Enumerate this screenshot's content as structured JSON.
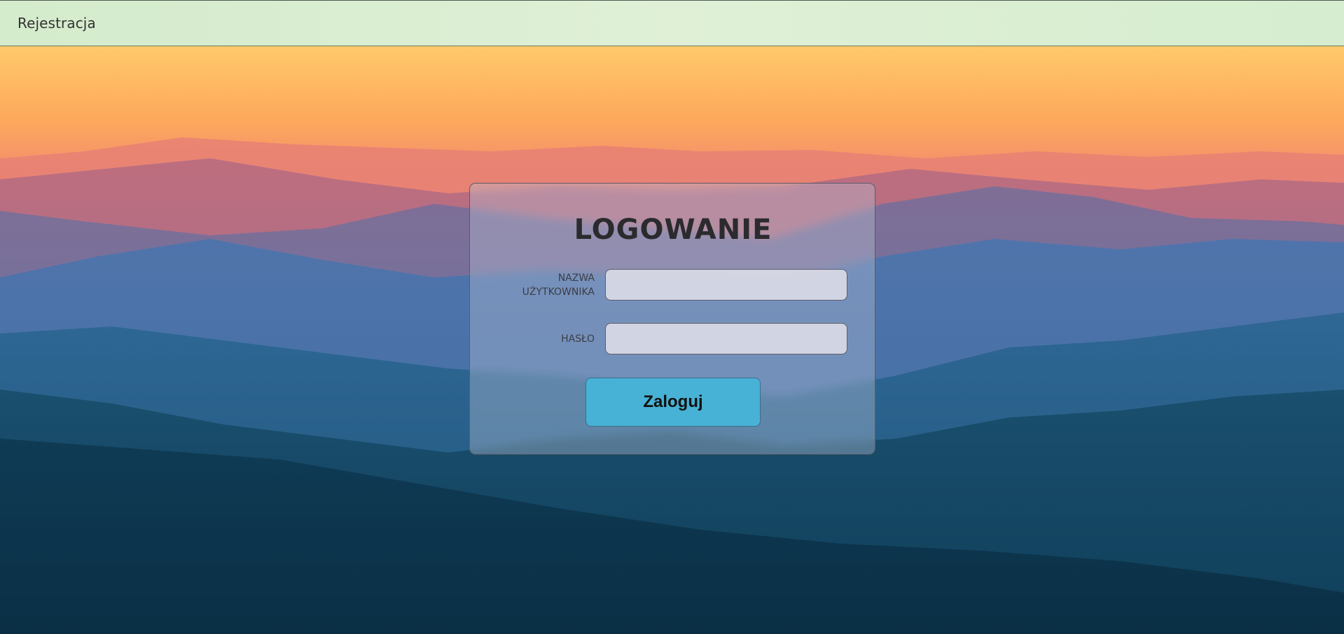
{
  "nav": {
    "register_link": "Rejestracja"
  },
  "login_form": {
    "title": "LOGOWANIE",
    "username_label": "NAZWA UŻYTKOWNIKA",
    "username_value": "",
    "password_label": "HASŁO",
    "password_value": "",
    "submit_label": "Zaloguj"
  },
  "colors": {
    "topbar_bg": "#d9eed2",
    "button_bg": "#47b2d5",
    "sky_top": "#ffc96a",
    "sky_bottom": "#f08a6a",
    "mountains_far": "#b56e82",
    "mountains_mid": "#4a78b3",
    "mountains_near": "#0d3a55"
  }
}
